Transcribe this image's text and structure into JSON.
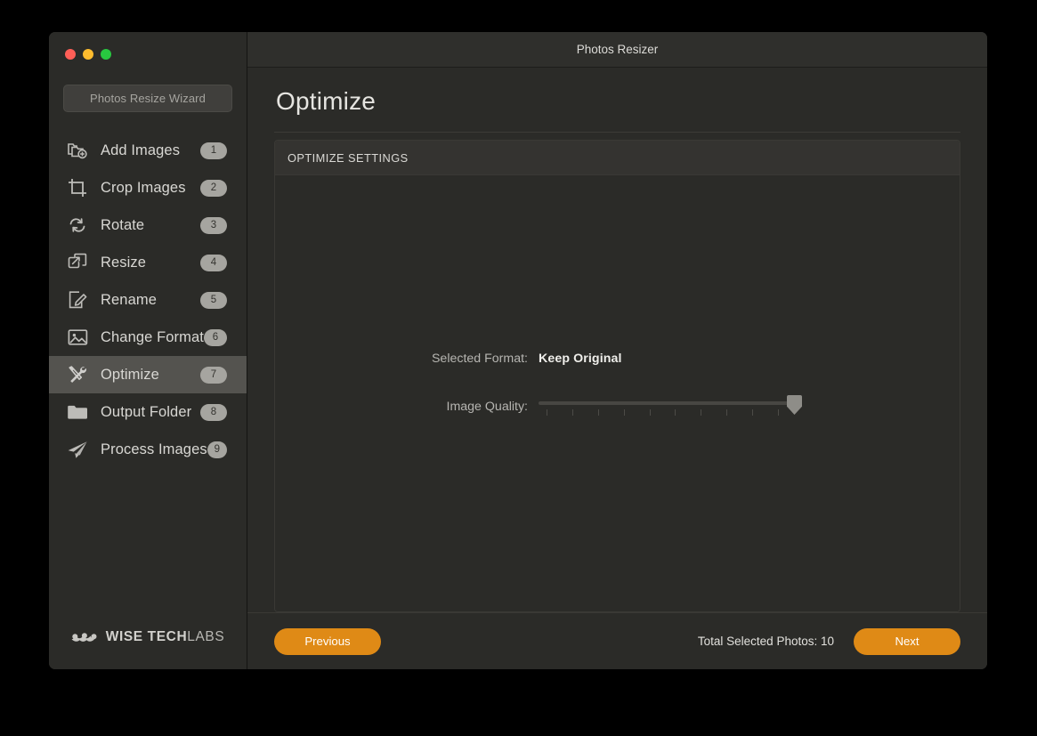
{
  "window": {
    "title": "Photos Resizer",
    "traffic_lights": [
      {
        "name": "close",
        "color": "#ff5f57"
      },
      {
        "name": "minimize",
        "color": "#febc2e"
      },
      {
        "name": "maximize",
        "color": "#28c840"
      }
    ]
  },
  "sidebar": {
    "wizard_button_label": "Photos Resize Wizard",
    "items": [
      {
        "label": "Add Images",
        "badge": "1",
        "icon": "add-images-icon",
        "active": false
      },
      {
        "label": "Crop Images",
        "badge": "2",
        "icon": "crop-icon",
        "active": false
      },
      {
        "label": "Rotate",
        "badge": "3",
        "icon": "rotate-icon",
        "active": false
      },
      {
        "label": "Resize",
        "badge": "4",
        "icon": "resize-icon",
        "active": false
      },
      {
        "label": "Rename",
        "badge": "5",
        "icon": "rename-icon",
        "active": false
      },
      {
        "label": "Change Format",
        "badge": "6",
        "icon": "image-icon",
        "active": false
      },
      {
        "label": "Optimize",
        "badge": "7",
        "icon": "tools-icon",
        "active": true
      },
      {
        "label": "Output Folder",
        "badge": "8",
        "icon": "folder-icon",
        "active": false
      },
      {
        "label": "Process Images",
        "badge": "9",
        "icon": "paper-plane-icon",
        "active": false
      }
    ],
    "brand": {
      "icon": "wise-tech-labs-logo",
      "name_bold": "WISE TECH",
      "name_light": "LABS"
    }
  },
  "main": {
    "page_title": "Optimize",
    "panel": {
      "header": "OPTIMIZE SETTINGS",
      "selected_format_label": "Selected Format:",
      "selected_format_value": "Keep Original",
      "image_quality_label": "Image Quality:",
      "slider": {
        "value_percent": 97,
        "tick_count": 10
      }
    }
  },
  "footer": {
    "previous_label": "Previous",
    "total_photos_text": "Total Selected Photos: 10",
    "next_label": "Next"
  },
  "colors": {
    "accent_orange": "#df8a16",
    "window_bg": "#2b2b28",
    "panel_header_bg": "#343330",
    "active_nav_bg": "#54534f",
    "badge_bg": "#a6a5a0"
  }
}
